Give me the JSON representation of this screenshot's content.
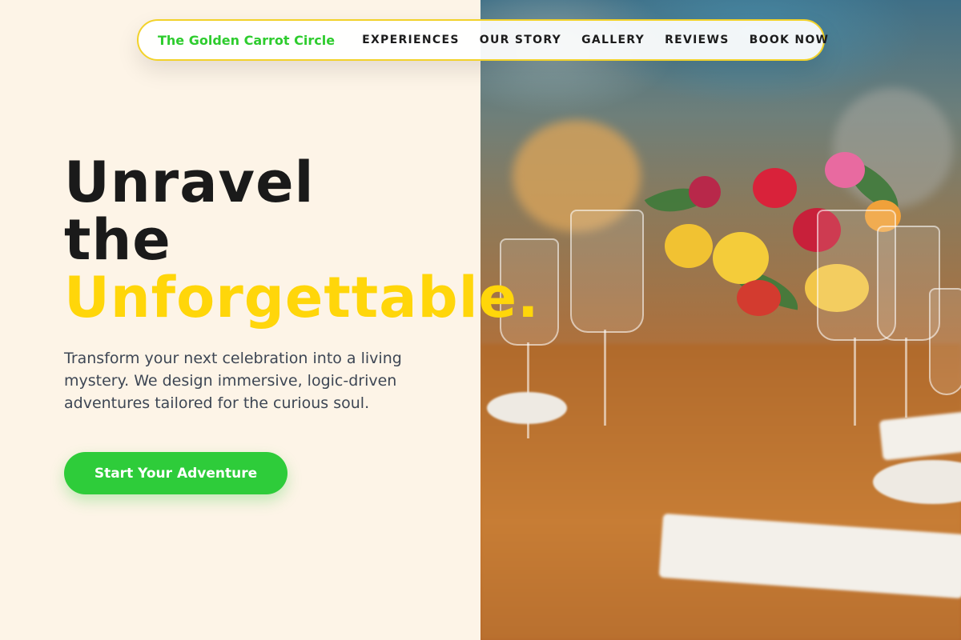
{
  "brand": {
    "name": "The Golden Carrot Circle",
    "color": "#2ecc2e"
  },
  "nav": {
    "links": [
      "EXPERIENCES",
      "OUR STORY",
      "GALLERY",
      "REVIEWS",
      "BOOK NOW"
    ]
  },
  "hero": {
    "title_line1": "Unravel",
    "title_line2": "the",
    "title_line3": "Unforgettable.",
    "accent_color": "#ffd60a",
    "description": "Transform your next celebration into a living mystery. We design immersive, logic-driven adventures tailored for the curious soul.",
    "cta_label": "Start Your Adventure",
    "cta_color": "#2ecc3a"
  },
  "photo": {
    "subject": "table-setting-with-flowers-and-glassware"
  }
}
